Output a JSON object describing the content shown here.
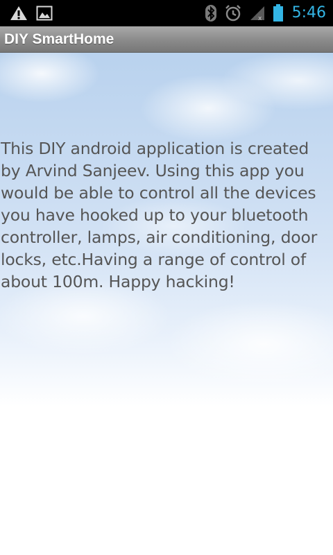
{
  "status_bar": {
    "time": "5:46",
    "accent_color": "#33b5e5",
    "left_icons": [
      "warning-icon",
      "image-icon"
    ],
    "right_icons": [
      "bluetooth-icon",
      "alarm-icon",
      "signal-icon",
      "battery-icon"
    ]
  },
  "app_bar": {
    "title": "DIY SmartHome"
  },
  "content": {
    "description": "This DIY android application is created by Arvind Sanjeev. Using this app you would be able to control all the devices you have hooked up to your bluetooth controller, lamps, air conditioning, door locks, etc.Having a range of control of about 100m. Happy hacking!"
  }
}
